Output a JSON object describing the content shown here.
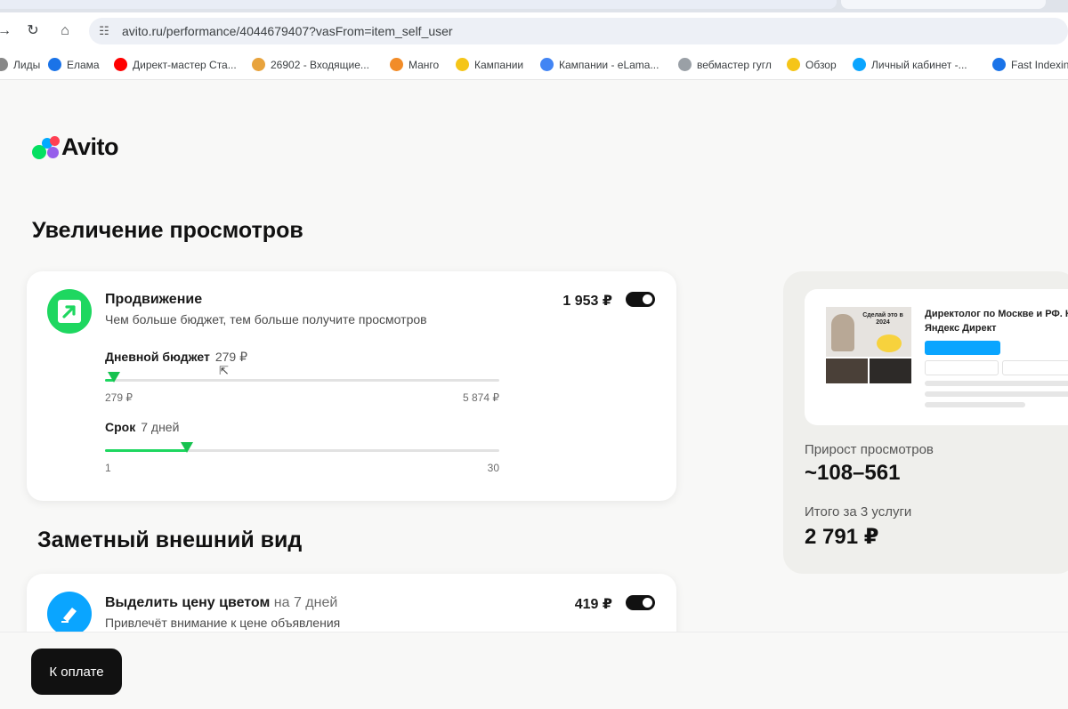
{
  "browser": {
    "url": "avito.ru/performance/4044679407?vasFrom=item_self_user",
    "bookmarks": [
      {
        "label": "Лиды",
        "icon": "leads-icon",
        "color": "#888888"
      },
      {
        "label": "Елама",
        "icon": "elama-icon",
        "color": "#1a73e8"
      },
      {
        "label": "Директ-мастер Ста...",
        "icon": "youtube-icon",
        "color": "#ff0000"
      },
      {
        "label": "26902 - Входящие...",
        "icon": "mail-icon",
        "color": "#e8a33d"
      },
      {
        "label": "Манго",
        "icon": "mango-icon",
        "color": "#f28c28"
      },
      {
        "label": "Кампании",
        "icon": "yandex-direct-icon",
        "color": "#f5c518"
      },
      {
        "label": "Кампании - eLama...",
        "icon": "google-ads-icon",
        "color": "#4285f4"
      },
      {
        "label": "вебмастер гугл",
        "icon": "webmaster-icon",
        "color": "#9aa0a6"
      },
      {
        "label": "Обзор",
        "icon": "yandex-metrica-icon",
        "color": "#f5c518"
      },
      {
        "label": "Личный кабинет -...",
        "icon": "avito-icon",
        "color": "#0aa5ff"
      },
      {
        "label": "Fast Indexin",
        "icon": "fast-indexing-icon",
        "color": "#1a73e8"
      }
    ]
  },
  "brand": {
    "name": "Avito"
  },
  "section_views": {
    "title": "Увеличение просмотров"
  },
  "promotion": {
    "title": "Продвижение",
    "subtitle": "Чем больше бюджет, тем больше получите просмотров",
    "price": "1 953 ₽",
    "enabled": true,
    "budget": {
      "label": "Дневной бюджет",
      "value": "279 ₽",
      "min": "279 ₽",
      "max": "5 874 ₽",
      "level": 0.0
    },
    "term": {
      "label": "Срок",
      "value": "7 дней",
      "min": "1",
      "max": "30",
      "level": 0.2069
    }
  },
  "section_look": {
    "title": "Заметный внешний вид"
  },
  "highlight": {
    "title": "Выделить цену цветом",
    "title_suffix": "на 7 дней",
    "subtitle": "Привлечёт внимание к цене объявления",
    "price": "419 ₽",
    "enabled": true
  },
  "summary": {
    "ad_title_line1": "Директолог по Москве и РФ. Н",
    "ad_title_line2": "Яндекс Директ",
    "thumb_text": "Сделай это в 2024",
    "views_label": "Прирост просмотров",
    "views_value": "~108–561",
    "total_label": "Итого за 3 услуги",
    "total_value": "2 791 ₽"
  },
  "footer": {
    "pay_label": "К оплате"
  },
  "colors": {
    "accent_green": "#1ed760",
    "dark": "#111111",
    "highlight_blue": "#0aa5ff"
  }
}
